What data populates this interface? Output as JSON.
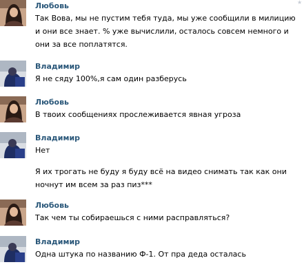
{
  "messages": [
    {
      "author": "Любовь",
      "avatar": "female-avatar",
      "lines": [
        "Так Вова, мы не пустим тебя туда, мы уже сообщили в милицию и они все знает. % уже вычислили, осталось совсем немного и они за все поплатятся."
      ]
    },
    {
      "author": "Владимир",
      "avatar": "male-avatar",
      "lines": [
        "Я не сяду 100%,я сам один разберусь"
      ]
    },
    {
      "author": "Любовь",
      "avatar": "female-avatar",
      "lines": [
        "В твоих сообщениях прослеживается явная угроза"
      ]
    },
    {
      "author": "Владимир",
      "avatar": "male-avatar",
      "lines": [
        "Нет",
        "Я их трогать не буду я буду всё на видео снимать так как они ночнут им всем за раз пиз***"
      ]
    },
    {
      "author": "Любовь",
      "avatar": "female-avatar",
      "lines": [
        "Так чем ты собираешься с ними расправляться?"
      ]
    },
    {
      "author": "Владимир",
      "avatar": "male-avatar",
      "lines": [
        "Одна штука по названию Ф-1. От пра деда осталась"
      ]
    }
  ],
  "colors": {
    "author_name": "#2b587a",
    "text": "#000000",
    "background": "#ffffff"
  }
}
